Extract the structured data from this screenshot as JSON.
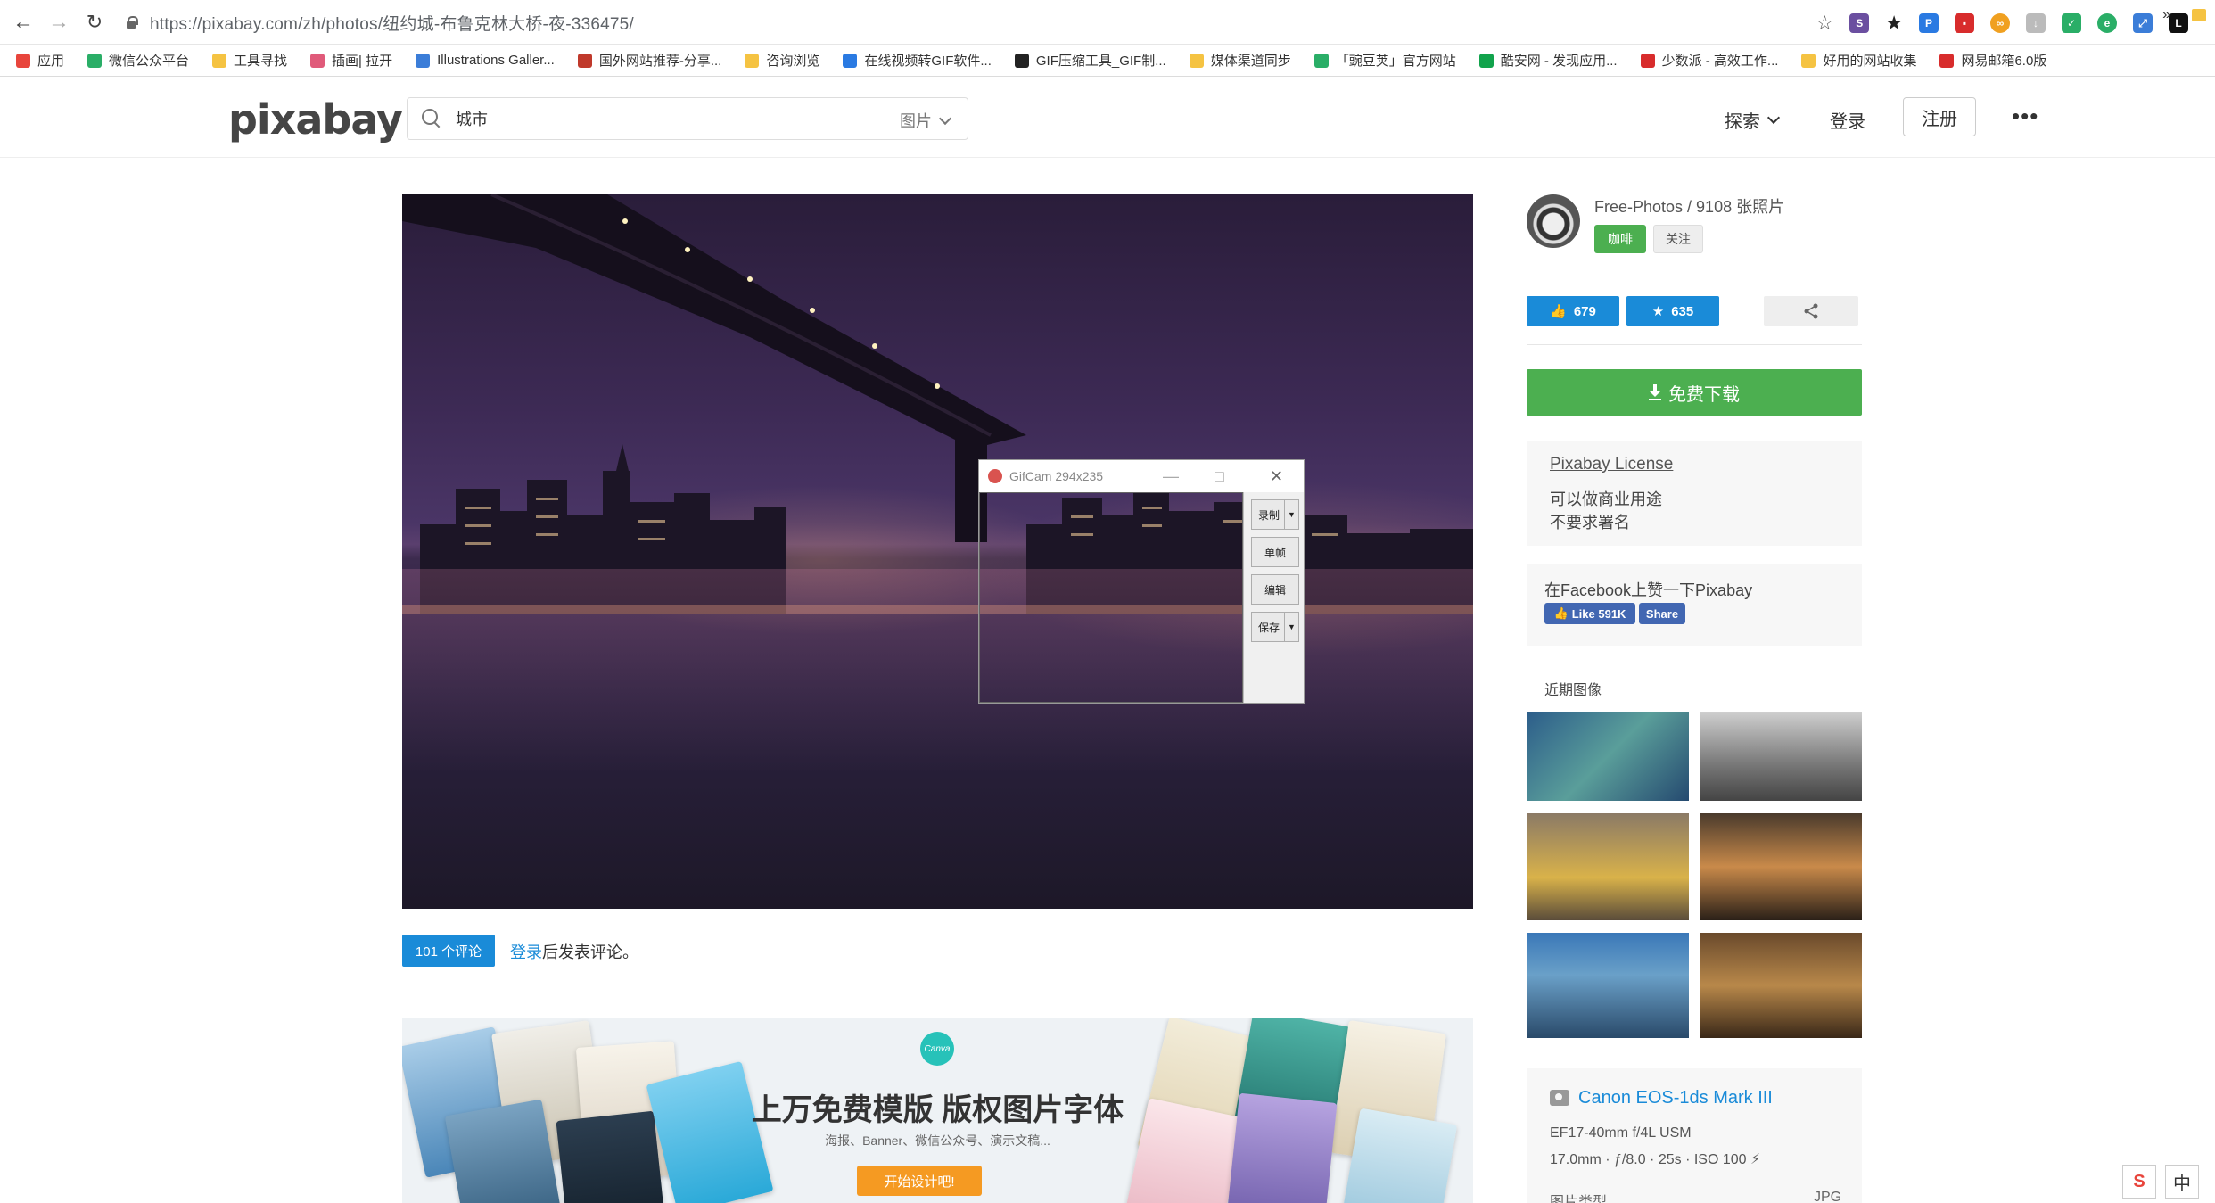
{
  "browser": {
    "url": "https://pixabay.com/zh/photos/纽约城-布鲁克林大桥-夜-336475/",
    "bookmarks": [
      {
        "label": "应用",
        "color": "#e8453c"
      },
      {
        "label": "微信公众平台",
        "color": "#2aae67"
      },
      {
        "label": "工具寻找",
        "color": "#f5c342"
      },
      {
        "label": "插画| 拉开",
        "color": "#e05a7a"
      },
      {
        "label": "Illustrations Galler...",
        "color": "#3b7dd8"
      },
      {
        "label": "国外网站推荐-分享...",
        "color": "#c0392b"
      },
      {
        "label": "咨询浏览",
        "color": "#f5c342"
      },
      {
        "label": "在线视频转GIF软件...",
        "color": "#2a7ae2"
      },
      {
        "label": "GIF压缩工具_GIF制...",
        "color": "#222222"
      },
      {
        "label": "媒体渠道同步",
        "color": "#f5c342"
      },
      {
        "label": "「豌豆荚」官方网站",
        "color": "#2aae67"
      },
      {
        "label": "酷安网 - 发现应用...",
        "color": "#11a34c"
      },
      {
        "label": "少数派 - 高效工作...",
        "color": "#d82c2c"
      },
      {
        "label": "好用的网站收集",
        "color": "#f5c342"
      },
      {
        "label": "网易邮箱6.0版",
        "color": "#d82c2c"
      }
    ],
    "bookmarks_more": "»"
  },
  "header": {
    "logo": "pixabay",
    "search_value": "城市",
    "search_type": "图片",
    "explore": "探索",
    "login": "登录",
    "signup": "注册",
    "more": "•••"
  },
  "gifcam": {
    "title": "GifCam 294x235",
    "minimize": "—",
    "maximize": "□",
    "close": "✕",
    "record": "录制",
    "frame": "单帧",
    "edit": "编辑",
    "save": "保存",
    "dropdown": "▼"
  },
  "comments": {
    "count_label": "101 个评论",
    "login_link": "登录",
    "login_suffix": "后发表评论。"
  },
  "banner": {
    "logo": "Canva",
    "title": "上万免费模版 版权图片字体",
    "subtitle": "海报、Banner、微信公众号、演示文稿...",
    "cta": "开始设计吧!"
  },
  "sidebar": {
    "author": "Free-Photos / 9108 张照片",
    "coffee": "咖啡",
    "follow": "关注",
    "likes": "679",
    "favorites": "635",
    "download": "免费下载",
    "license_title": "Pixabay License",
    "license_lines": [
      "可以做商业用途",
      "不要求署名"
    ],
    "facebook_title": "在Facebook上赞一下Pixabay",
    "fb_like": "Like 591K",
    "fb_share": "Share",
    "recent_title": "近期图像",
    "camera": "Canon EOS-1ds Mark III",
    "lens": "EF17-40mm f/4L USM",
    "exposure": "17.0mm · ƒ/8.0 · 25s · ISO 100 ⚡",
    "image_type_label": "图片类型",
    "image_type_value": "JPG"
  },
  "ime": {
    "sogou": "S",
    "lang": "中"
  }
}
